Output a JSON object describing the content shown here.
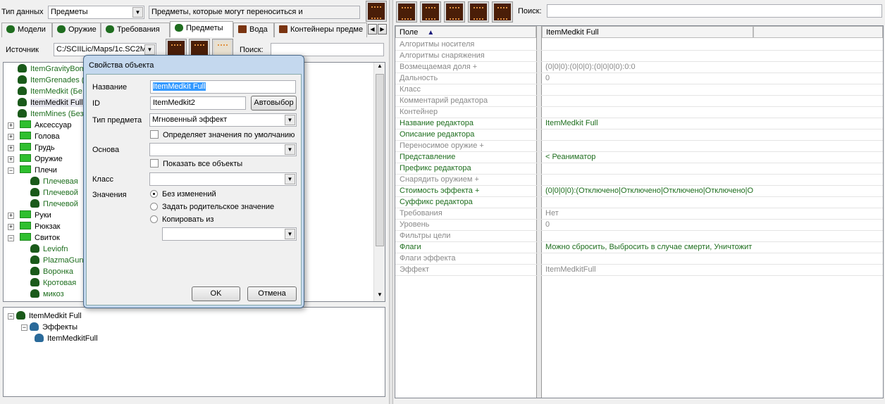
{
  "left": {
    "datatype_label": "Тип данных",
    "datatype_value": "Предметы",
    "datatype_description": "Предметы, которые могут переноситься и",
    "tabs": [
      {
        "label": "Модели",
        "icon": "models-icon"
      },
      {
        "label": "Оружие",
        "icon": "weapon-icon"
      },
      {
        "label": "Требования",
        "icon": "requirements-icon"
      },
      {
        "label": "Предметы",
        "icon": "items-icon",
        "active": true
      },
      {
        "label": "Вода",
        "icon": "water-icon"
      },
      {
        "label": "Контейнеры предме",
        "icon": "containers-icon"
      }
    ],
    "source_label": "Источник",
    "source_value": "C:/SCIILic/Maps/1c.SC2M",
    "search_label": "Поиск:",
    "search_value": "",
    "tree": [
      {
        "label": "ItemGravityBom",
        "type": "leaf",
        "green": true,
        "level": 1
      },
      {
        "label": "ItemGrenades (",
        "type": "leaf",
        "green": true,
        "level": 1
      },
      {
        "label": "ItemMedkit (Бе",
        "type": "leaf",
        "green": true,
        "level": 1
      },
      {
        "label": "ItemMedkit Full",
        "type": "leaf",
        "green": false,
        "level": 1,
        "selected": true
      },
      {
        "label": "ItemMines (Без",
        "type": "leaf",
        "green": true,
        "level": 1
      },
      {
        "label": "Аксессуар",
        "type": "folder",
        "expanded": false
      },
      {
        "label": "Голова",
        "type": "folder",
        "expanded": false
      },
      {
        "label": "Грудь",
        "type": "folder",
        "expanded": false
      },
      {
        "label": "Оружие",
        "type": "folder",
        "expanded": false
      },
      {
        "label": "Плечи",
        "type": "folder",
        "expanded": true
      },
      {
        "label": "Плечевая",
        "type": "leaf",
        "green": true,
        "level": 2
      },
      {
        "label": "Плечевой",
        "type": "leaf",
        "green": true,
        "level": 2
      },
      {
        "label": "Плечевой",
        "type": "leaf",
        "green": true,
        "level": 2
      },
      {
        "label": "Руки",
        "type": "folder",
        "expanded": false
      },
      {
        "label": "Рюкзак",
        "type": "folder",
        "expanded": false
      },
      {
        "label": "Свиток",
        "type": "folder",
        "expanded": true
      },
      {
        "label": "Leviofn",
        "type": "leaf",
        "green": true,
        "level": 2
      },
      {
        "label": "PlazmaGun",
        "type": "leaf",
        "green": true,
        "level": 2
      },
      {
        "label": "Воронка",
        "type": "leaf",
        "green": true,
        "level": 2
      },
      {
        "label": "Кротовая",
        "type": "leaf",
        "green": true,
        "level": 2
      },
      {
        "label": "микоз",
        "type": "leaf",
        "green": true,
        "level": 2
      }
    ],
    "bottom_tree": [
      {
        "label": "ItemMedkit Full",
        "level": 0
      },
      {
        "label": "Эффекты",
        "level": 1
      },
      {
        "label": "ItemMedkitFull",
        "level": 2
      }
    ]
  },
  "dialog": {
    "title": "Свойства объекта",
    "name_label": "Название",
    "name_value": "ItemMedkit Full",
    "id_label": "ID",
    "id_value": "ItemMedkit2",
    "autoselect_label": "Автовыбор",
    "item_type_label": "Тип предмета",
    "item_type_value": "Мгновенный эффект",
    "defines_defaults_label": "Определяет значения по умолчанию",
    "defines_defaults_checked": false,
    "base_label": "Основа",
    "base_value": "",
    "show_all_label": "Показать все объекты",
    "show_all_checked": false,
    "class_label": "Класс",
    "class_value": "",
    "values_label": "Значения",
    "radio_options": [
      "Без изменений",
      "Задать родительское значение",
      "Копировать из"
    ],
    "radio_selected": 0,
    "copy_from_value": "",
    "ok_label": "OK",
    "cancel_label": "Отмена"
  },
  "right": {
    "search_label": "Поиск:",
    "search_value": "",
    "col_field": "Поле",
    "col_value": "ItemMedkit Full",
    "rows": [
      {
        "field": "Алгоритмы носителя",
        "value": "",
        "green": false
      },
      {
        "field": "Алгоритмы снаряжения",
        "value": "",
        "green": false
      },
      {
        "field": "Возмещаемая доля +",
        "value": "(0|0|0):(0|0|0):(0|0|0|0):0:0",
        "green": false
      },
      {
        "field": "Дальность",
        "value": "0",
        "green": false
      },
      {
        "field": "Класс",
        "value": "",
        "green": false
      },
      {
        "field": "Комментарий редактора",
        "value": "",
        "green": false
      },
      {
        "field": "Контейнер",
        "value": "",
        "green": false
      },
      {
        "field": "Название редактора",
        "value": "ItemMedkit Full",
        "green": true
      },
      {
        "field": "Описание редактора",
        "value": "",
        "green": true
      },
      {
        "field": "Переносимое оружие +",
        "value": "",
        "green": false
      },
      {
        "field": "Представление",
        "value": "< Реаниматор",
        "green": true
      },
      {
        "field": "Префикс редактора",
        "value": "",
        "green": true
      },
      {
        "field": "Снарядить оружием +",
        "value": "",
        "green": false
      },
      {
        "field": "Стоимость эффекта +",
        "value": "(0|0|0|0):(Отключено|Отключено|Отключено|Отключено|Отк",
        "green": true
      },
      {
        "field": "Суффикс редактора",
        "value": "",
        "green": true
      },
      {
        "field": "Требования",
        "value": "Нет",
        "green": false
      },
      {
        "field": "Уровень",
        "value": "0",
        "green": false
      },
      {
        "field": "Фильтры цели",
        "value": "",
        "green": false
      },
      {
        "field": "Флаги",
        "value": "Можно сбросить, Выбросить в случае смерти, Уничтожит",
        "green": true
      },
      {
        "field": "Флаги эффекта",
        "value": "",
        "green": false
      },
      {
        "field": "Эффект",
        "value": "ItemMedkitFull",
        "green": false
      }
    ]
  }
}
